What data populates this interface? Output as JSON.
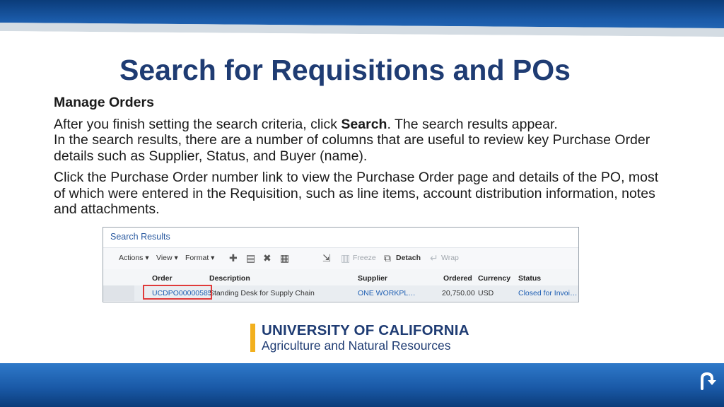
{
  "slide": {
    "title": "Search for Requisitions and POs",
    "section_heading": "Manage Orders",
    "para1": {
      "line1_before": "After you finish setting the search criteria, click ",
      "line1_bold": "Search",
      "line1_after": ". The search results appear.",
      "line2": "In the search results, there are a number of columns that are useful to review key Purchase Order details such as Supplier, Status, and Buyer (name)."
    },
    "para2": "Click the Purchase Order number link to view the Purchase Order page and details of the PO, most of which were entered in the Requisition, such as line items, account distribution information, notes and attachments."
  },
  "screenshot": {
    "title": "Search Results",
    "toolbar": {
      "actions": "Actions",
      "view": "View",
      "format": "Format",
      "freeze": "Freeze",
      "detach": "Detach",
      "wrap": "Wrap"
    },
    "columns": {
      "order": "Order",
      "description": "Description",
      "supplier": "Supplier",
      "ordered": "Ordered",
      "currency": "Currency",
      "status": "Status"
    },
    "row": {
      "order": "UCDPO00000585",
      "description": "Standing Desk for Supply Chain",
      "supplier": "ONE WORKPL…",
      "ordered": "20,750.00",
      "currency": "USD",
      "status": "Closed for Invoi…"
    }
  },
  "logo": {
    "line1": "UNIVERSITY OF CALIFORNIA",
    "line2": "Agriculture and Natural Resources"
  },
  "colors": {
    "title": "#1f3c73",
    "band_dark": "#0b3c7a",
    "band_light": "#2f79c9",
    "link": "#1f5fb3",
    "highlight": "#e03a3a",
    "logo_gold": "#f2b01e"
  }
}
